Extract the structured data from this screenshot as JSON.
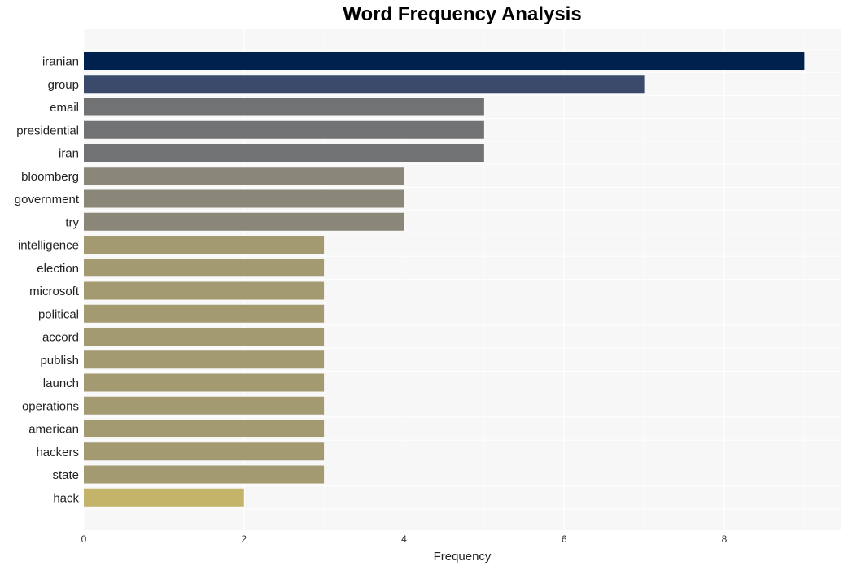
{
  "chart_data": {
    "type": "bar",
    "orientation": "horizontal",
    "title": "Word Frequency Analysis",
    "xlabel": "Frequency",
    "ylabel": "",
    "xlim": [
      0,
      9.45
    ],
    "xticks": [
      0,
      2,
      4,
      6,
      8
    ],
    "grid": true,
    "categories": [
      "iranian",
      "group",
      "email",
      "presidential",
      "iran",
      "bloomberg",
      "government",
      "try",
      "intelligence",
      "election",
      "microsoft",
      "political",
      "accord",
      "publish",
      "launch",
      "operations",
      "american",
      "hackers",
      "state",
      "hack"
    ],
    "values": [
      9,
      7,
      5,
      5,
      5,
      4,
      4,
      4,
      3,
      3,
      3,
      3,
      3,
      3,
      3,
      3,
      3,
      3,
      3,
      2
    ],
    "colors": [
      "#00204e",
      "#3b4a6b",
      "#717274",
      "#717274",
      "#717274",
      "#8a8778",
      "#8a8778",
      "#8a8778",
      "#a39a72",
      "#a39a72",
      "#a39a72",
      "#a39a72",
      "#a39a72",
      "#a39a72",
      "#a39a72",
      "#a39a72",
      "#a39a72",
      "#a39a72",
      "#a39a72",
      "#c4b46a"
    ],
    "plot_background": "#f7f7f7",
    "grid_color": "#ffffff"
  }
}
